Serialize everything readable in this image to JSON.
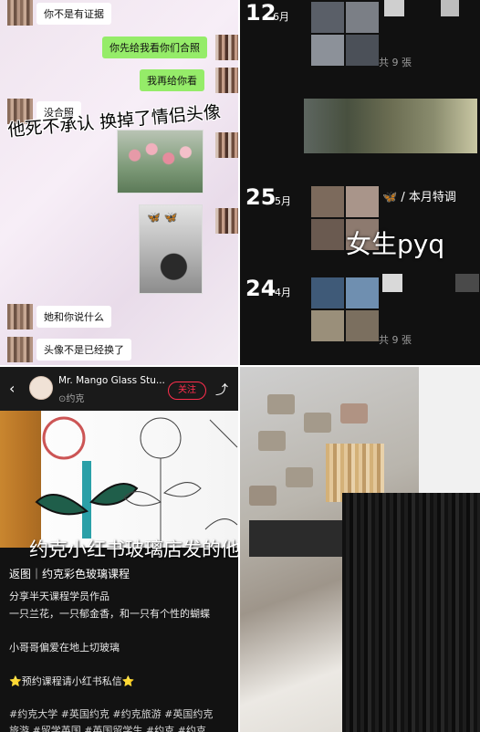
{
  "chat": {
    "messages": [
      {
        "side": "in",
        "text": "你不是有证据"
      },
      {
        "side": "out",
        "text": "你先给我看你们合照"
      },
      {
        "side": "out",
        "text": "我再给你看"
      },
      {
        "side": "in",
        "text": "没合照"
      },
      {
        "side": "in",
        "text": "她和你说什么"
      },
      {
        "side": "in",
        "text": "头像不是已经换了"
      }
    ],
    "overlay_caption": "他死不承认 换掉了情侣头像"
  },
  "moments": {
    "posts": [
      {
        "day": "12",
        "month": "6月",
        "count": "共 9 張"
      },
      {
        "day": "25",
        "month": "5月",
        "text": "🦋 / 本月特调"
      },
      {
        "day": "24",
        "month": "4月",
        "count": "共 9 張"
      }
    ],
    "overlay_caption": "女生pyq"
  },
  "rednote": {
    "back_icon": "chevron-left-icon",
    "author": "Mr. Mango Glass Stu...",
    "location": "⊙约克",
    "follow_label": "关注",
    "share_icon": "share-icon",
    "overlay_caption": "约克小红书玻璃店发的他",
    "title": "返图｜约克彩色玻璃课程",
    "lines": [
      "分享半天课程学员作品",
      "一只兰花，一只郁金香，和一只有个性的蝴蝶",
      "小哥哥偏爱在地上切玻璃",
      "⭐预约课程请小红书私信⭐"
    ],
    "tags_line1": "#约克大学  #英国约克  #约克旅游  #英国约克",
    "tags_line2": "旅游  #留学英国  #英国留学生  #约克  #约克"
  },
  "colors": {
    "wechat_green": "#95ec69",
    "rednote_red": "#ff2e4d"
  }
}
